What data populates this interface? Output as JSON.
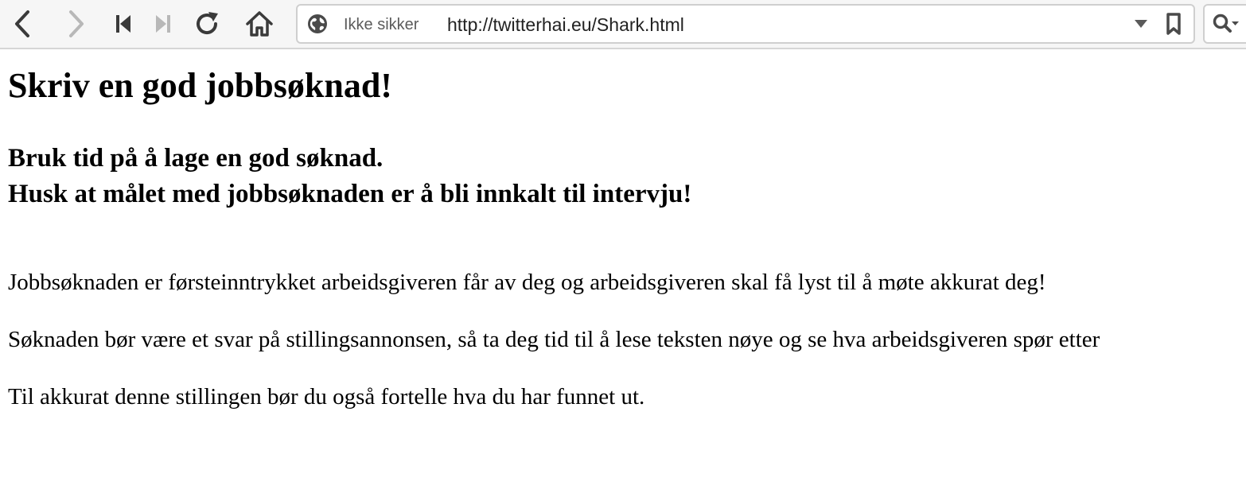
{
  "browser": {
    "security_label": "Ikke sikker",
    "url": "http://twitterhai.eu/Shark.html"
  },
  "icons": {
    "back": "chevron-left-icon",
    "forward": "chevron-right-icon",
    "first": "skip-to-start-icon",
    "last": "skip-to-end-icon",
    "reload": "reload-icon",
    "home": "home-icon",
    "globe": "globe-icon",
    "dropdown": "triangle-down-icon",
    "bookmark": "bookmark-icon",
    "search": "search-icon"
  },
  "page": {
    "title": "Skriv en god jobbsøknad!",
    "subheading_line1": "Bruk tid på å lage en god søknad.",
    "subheading_line2": "Husk at målet med jobbsøknaden er å bli innkalt til intervju!",
    "paragraphs": [
      "Jobbsøknaden er førsteinntrykket arbeidsgiveren får av deg og arbeidsgiveren skal få lyst til å møte akkurat deg!",
      "Søknaden bør være et svar på stillingsannonsen, så ta deg tid til å lese teksten nøye og se hva arbeidsgiveren spør etter",
      "Til akkurat denne stillingen bør du også fortelle hva du har funnet ut."
    ]
  }
}
